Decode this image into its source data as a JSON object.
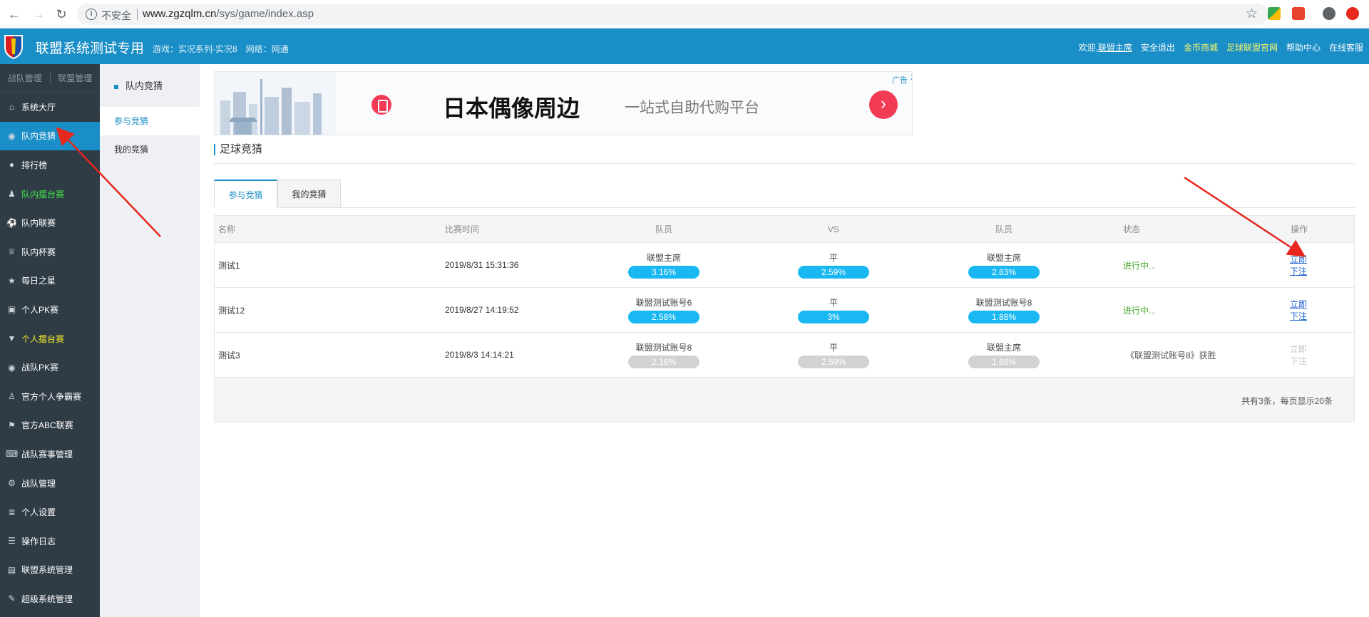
{
  "browser": {
    "insecure_label": "不安全",
    "url_host": "www.zgzqlm.cn",
    "url_path": "/sys/game/index.asp"
  },
  "header": {
    "site_title": "联盟系统测试专用",
    "game_info": "游戏：实况系列-实况8　网络：网通",
    "welcome": "欢迎,",
    "user": "联盟主席",
    "logout": "安全退出",
    "coin_mall": "金币商城",
    "official_site": "足球联盟官网",
    "help": "帮助中心",
    "support": "在线客服"
  },
  "sidebar": {
    "tabs": [
      "战队管理",
      "联盟管理"
    ],
    "items": [
      {
        "label": "系统大厅",
        "icon": "home-icon"
      },
      {
        "label": "队内竞猜",
        "icon": "pk-icon"
      },
      {
        "label": "排行榜",
        "icon": "bulb-icon"
      },
      {
        "label": "队内擂台赛",
        "icon": "group-icon"
      },
      {
        "label": "队内联赛",
        "icon": "ball-icon"
      },
      {
        "label": "队内杯赛",
        "icon": "trophy-icon"
      },
      {
        "label": "每日之星",
        "icon": "star-icon"
      },
      {
        "label": "个人PK赛",
        "icon": "pk-icon"
      },
      {
        "label": "个人擂台赛",
        "icon": "v-icon"
      },
      {
        "label": "战队PK赛",
        "icon": "pk-icon"
      },
      {
        "label": "官方个人争霸赛",
        "icon": "user-icon"
      },
      {
        "label": "官方ABC联赛",
        "icon": "flag-icon"
      },
      {
        "label": "战队赛事管理",
        "icon": "gamepad-icon"
      },
      {
        "label": "战队管理",
        "icon": "gear-icon"
      },
      {
        "label": "个人设置",
        "icon": "list-icon"
      },
      {
        "label": "操作日志",
        "icon": "log-icon"
      },
      {
        "label": "联盟系统管理",
        "icon": "doc-icon"
      },
      {
        "label": "超级系统管理",
        "icon": "wrench-icon"
      }
    ]
  },
  "subnav": {
    "heading": "队内竞猜",
    "items": [
      "参与竞猜",
      "我的竞猜"
    ]
  },
  "ad": {
    "headline": "日本偶像周边",
    "slogan": "一站式自助代购平台",
    "label": "广告"
  },
  "section": {
    "title": "足球竞猜",
    "tabs": [
      "参与竞猜",
      "我的竞猜"
    ]
  },
  "table": {
    "headers": [
      "名称",
      "比赛时间",
      "队员",
      "VS",
      "队员",
      "状态",
      "操作"
    ],
    "rows": [
      {
        "name": "测试1",
        "time": "2019/8/31 15:31:36",
        "p1": "联盟主席",
        "p1_pct": "3.16%",
        "vs": "平",
        "vs_pct": "2.59%",
        "p2": "联盟主席",
        "p2_pct": "2.83%",
        "status": "进行中...",
        "op": "立即下注"
      },
      {
        "name": "测试12",
        "time": "2019/8/27 14:19:52",
        "p1": "联盟测试账号6",
        "p1_pct": "2.58%",
        "vs": "平",
        "vs_pct": "3%",
        "p2": "联盟测试账号8",
        "p2_pct": "1.88%",
        "status": "进行中...",
        "op": "立即下注"
      },
      {
        "name": "测试3",
        "time": "2019/8/3 14:14:21",
        "p1": "联盟测试账号8",
        "p1_pct": "2.16%",
        "vs": "平",
        "vs_pct": "2.59%",
        "p2": "联盟主席",
        "p2_pct": "1.68%",
        "status": "《联盟测试账号8》获胜",
        "op": "立即下注"
      }
    ],
    "footer": "共有3条，每页显示20条"
  },
  "colors": {
    "accent": "#1a8ec6",
    "sidebar_bg": "#2f3b45",
    "pill_active": "#19b8f2",
    "pill_closed": "#d2d2d2",
    "status_green": "#44a827",
    "annotation_arrow": "#e8271f"
  }
}
